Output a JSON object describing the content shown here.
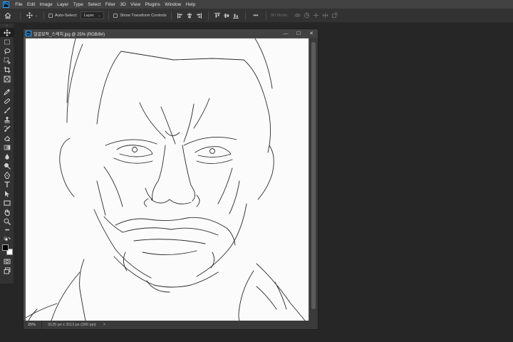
{
  "app": {
    "logo": "Ps",
    "menu": [
      "File",
      "Edit",
      "Image",
      "Layer",
      "Type",
      "Select",
      "Filter",
      "3D",
      "View",
      "Plugins",
      "Window",
      "Help"
    ]
  },
  "options_bar": {
    "auto_select_label": "Auto-Select:",
    "auto_select_target": "Layer",
    "show_transform_label": "Show Transform Controls",
    "mode_3d_label": "3D Mode:"
  },
  "toolbar": {
    "tools": [
      "move",
      "marquee",
      "lasso",
      "object-select",
      "crop",
      "frame",
      "eyedropper",
      "healing",
      "brush",
      "stamp",
      "history-brush",
      "eraser",
      "gradient",
      "blur",
      "dodge",
      "pen",
      "type",
      "path-select",
      "rectangle",
      "hand",
      "zoom",
      "more"
    ]
  },
  "document": {
    "title": "얼굴묘작_스케치.jpg @ 25% (RGB/8#)",
    "zoom": "25%",
    "info": "3125 px x 3113 px (300 ppi)",
    "status_arrow": ">"
  },
  "colors": {
    "accent": "#30a8ff",
    "panel": "#323232",
    "background": "#262626"
  }
}
